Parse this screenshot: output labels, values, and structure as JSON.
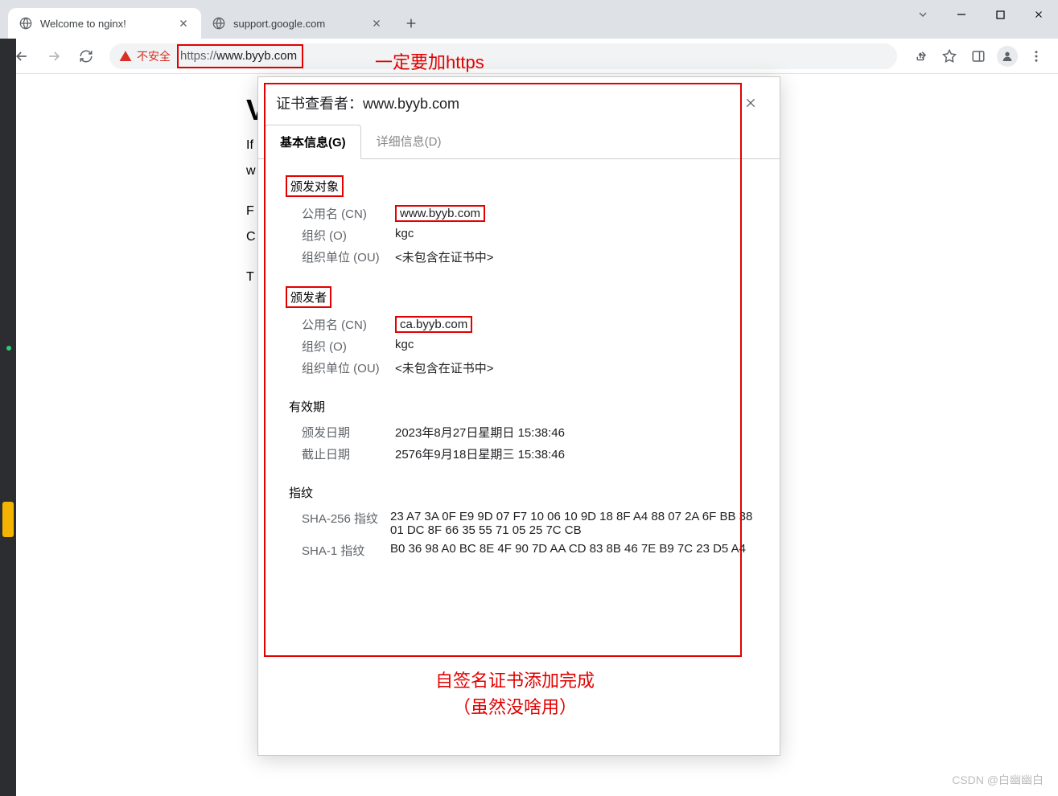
{
  "window": {
    "tabs": [
      {
        "title": "Welcome to nginx!",
        "favicon": "globe"
      },
      {
        "title": "support.google.com",
        "favicon": "globe"
      }
    ]
  },
  "toolbar": {
    "security_label": "不安全",
    "url_protocol": "https",
    "url_sep": "://",
    "url_host": "www.byyb.com"
  },
  "annotations": {
    "url_note": "一定要加https",
    "bottom_line1": "自签名证书添加完成",
    "bottom_line2": "（虽然没啥用）"
  },
  "page": {
    "h1_visible": "V",
    "p1": "If",
    "p2": "w",
    "p3": "F",
    "p4": "C",
    "p5": "T"
  },
  "dialog": {
    "title_prefix": "证书查看者：",
    "title_host": "www.byyb.com",
    "tab_general": "基本信息(G)",
    "tab_details": "详细信息(D)",
    "subject": {
      "heading": "颁发对象",
      "cn_label": "公用名 (CN)",
      "cn_value": "www.byyb.com",
      "o_label": "组织 (O)",
      "o_value": "kgc",
      "ou_label": "组织单位 (OU)",
      "ou_value": "<未包含在证书中>"
    },
    "issuer": {
      "heading": "颁发者",
      "cn_label": "公用名 (CN)",
      "cn_value": "ca.byyb.com",
      "o_label": "组织 (O)",
      "o_value": "kgc",
      "ou_label": "组织单位 (OU)",
      "ou_value": "<未包含在证书中>"
    },
    "validity": {
      "heading": "有效期",
      "issued_label": "颁发日期",
      "issued_value": "2023年8月27日星期日 15:38:46",
      "expires_label": "截止日期",
      "expires_value": "2576年9月18日星期三 15:38:46"
    },
    "fingerprints": {
      "heading": "指纹",
      "sha256_label": "SHA-256 指纹",
      "sha256_value": "23 A7 3A 0F E9 9D 07 F7 10 06 10 9D 18 8F A4 88 07 2A 6F BB 38 01 DC 8F 66 35 55 71 05 25 7C CB",
      "sha1_label": "SHA-1 指纹",
      "sha1_value": "B0 36 98 A0 BC 8E 4F 90 7D AA CD 83 8B 46 7E B9 7C 23 D5 A4"
    }
  },
  "watermark": "CSDN @白幽幽白"
}
